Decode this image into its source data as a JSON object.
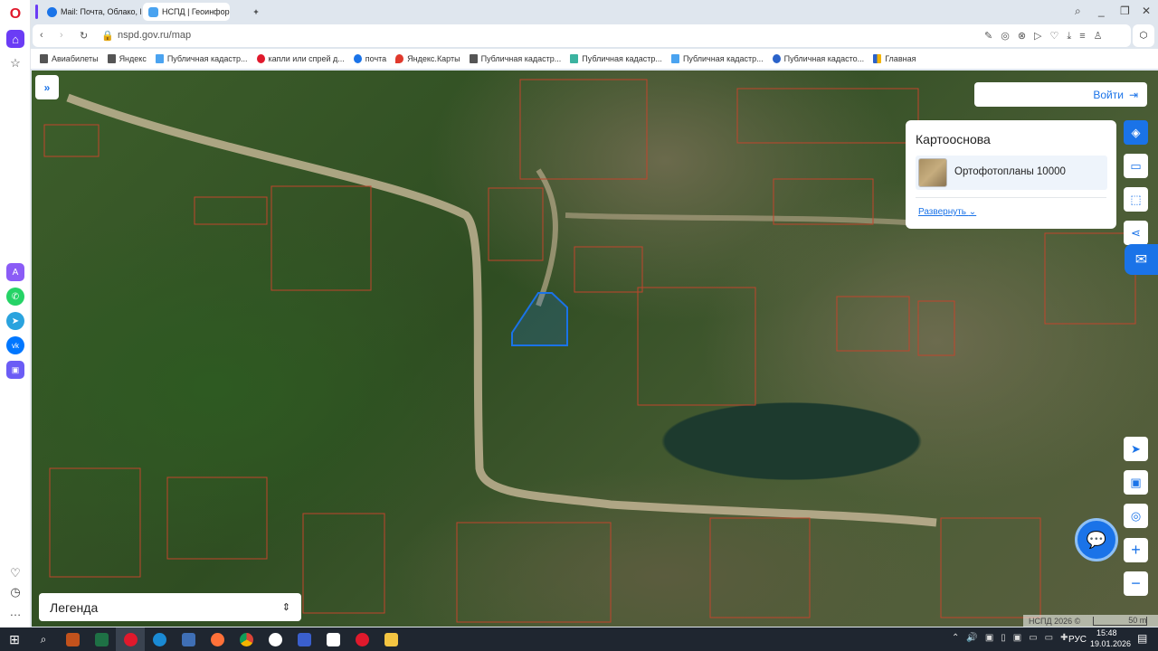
{
  "browser": {
    "tabs": [
      {
        "label": "Mail: Почта, Облако, Кал",
        "active": false
      },
      {
        "label": "НСПД | Геоинформацион",
        "active": true
      }
    ],
    "url": "nspd.gov.ru/map",
    "bookmarks": [
      "Авиабилеты",
      "Яндекс",
      "Публичная кадастр...",
      "капли или спрей д...",
      "почта",
      "Яндекс.Карты",
      "Публичная кадастр...",
      "Публичная кадастр...",
      "Публичная кадастр...",
      "Публичная кадасто...",
      "Главная"
    ]
  },
  "map": {
    "login_label": "Войти",
    "basemap_panel": {
      "title": "Картооснова",
      "selected": "Ортофотопланы 10000",
      "expand_label": "Развернуть"
    },
    "legend_label": "Легенда",
    "attribution": "НСПД 2026 ©",
    "scale_label": "50 m",
    "accent": "#1a73e8"
  },
  "taskbar": {
    "lang": "РУС",
    "time": "15:48",
    "date": "19.01.2026"
  }
}
